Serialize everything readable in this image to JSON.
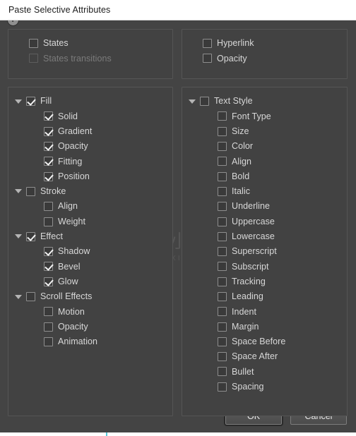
{
  "window": {
    "title": "Paste Selective Attributes"
  },
  "panels": {
    "states": {
      "name": "states-panel",
      "rows": [
        {
          "label": "States",
          "checked": false,
          "disabled": false,
          "indent": "flat",
          "triangle": false
        },
        {
          "label": "States transitions",
          "checked": false,
          "disabled": true,
          "indent": "flat",
          "triangle": false
        }
      ]
    },
    "hyperlink": {
      "name": "hyperlink-panel",
      "rows": [
        {
          "label": "Hyperlink",
          "checked": false,
          "disabled": false,
          "indent": "flat",
          "triangle": false
        },
        {
          "label": "Opacity",
          "checked": false,
          "disabled": false,
          "indent": "flat",
          "triangle": false
        }
      ]
    },
    "objects": {
      "name": "object-attributes-panel",
      "rows": [
        {
          "label": "Fill",
          "checked": true,
          "disabled": false,
          "indent": "parent",
          "triangle": true
        },
        {
          "label": "Solid",
          "checked": true,
          "disabled": false,
          "indent": "child",
          "triangle": false
        },
        {
          "label": "Gradient",
          "checked": true,
          "disabled": false,
          "indent": "child",
          "triangle": false
        },
        {
          "label": "Opacity",
          "checked": true,
          "disabled": false,
          "indent": "child",
          "triangle": false
        },
        {
          "label": "Fitting",
          "checked": true,
          "disabled": false,
          "indent": "child",
          "triangle": false
        },
        {
          "label": "Position",
          "checked": true,
          "disabled": false,
          "indent": "child",
          "triangle": false
        },
        {
          "label": "Stroke",
          "checked": false,
          "disabled": false,
          "indent": "parent",
          "triangle": true
        },
        {
          "label": "Align",
          "checked": false,
          "disabled": false,
          "indent": "child",
          "triangle": false
        },
        {
          "label": "Weight",
          "checked": false,
          "disabled": false,
          "indent": "child",
          "triangle": false
        },
        {
          "label": "Effect",
          "checked": true,
          "disabled": false,
          "indent": "parent",
          "triangle": true
        },
        {
          "label": "Shadow",
          "checked": true,
          "disabled": false,
          "indent": "child",
          "triangle": false
        },
        {
          "label": "Bevel",
          "checked": true,
          "disabled": false,
          "indent": "child",
          "triangle": false
        },
        {
          "label": "Glow",
          "checked": true,
          "disabled": false,
          "indent": "child",
          "triangle": false
        },
        {
          "label": "Scroll Effects",
          "checked": false,
          "disabled": false,
          "indent": "parent",
          "triangle": true
        },
        {
          "label": "Motion",
          "checked": false,
          "disabled": false,
          "indent": "child",
          "triangle": false
        },
        {
          "label": "Opacity",
          "checked": false,
          "disabled": false,
          "indent": "child",
          "triangle": false
        },
        {
          "label": "Animation",
          "checked": false,
          "disabled": false,
          "indent": "child",
          "triangle": false
        }
      ]
    },
    "text": {
      "name": "text-style-panel",
      "rows": [
        {
          "label": "Text Style",
          "checked": false,
          "disabled": false,
          "indent": "parent",
          "triangle": true
        },
        {
          "label": "Font Type",
          "checked": false,
          "disabled": false,
          "indent": "child",
          "triangle": false
        },
        {
          "label": "Size",
          "checked": false,
          "disabled": false,
          "indent": "child",
          "triangle": false
        },
        {
          "label": "Color",
          "checked": false,
          "disabled": false,
          "indent": "child",
          "triangle": false
        },
        {
          "label": "Align",
          "checked": false,
          "disabled": false,
          "indent": "child",
          "triangle": false
        },
        {
          "label": "Bold",
          "checked": false,
          "disabled": false,
          "indent": "child",
          "triangle": false
        },
        {
          "label": "Italic",
          "checked": false,
          "disabled": false,
          "indent": "child",
          "triangle": false
        },
        {
          "label": "Underline",
          "checked": false,
          "disabled": false,
          "indent": "child",
          "triangle": false
        },
        {
          "label": "Uppercase",
          "checked": false,
          "disabled": false,
          "indent": "child",
          "triangle": false
        },
        {
          "label": "Lowercase",
          "checked": false,
          "disabled": false,
          "indent": "child",
          "triangle": false
        },
        {
          "label": "Superscript",
          "checked": false,
          "disabled": false,
          "indent": "child",
          "triangle": false
        },
        {
          "label": "Subscript",
          "checked": false,
          "disabled": false,
          "indent": "child",
          "triangle": false
        },
        {
          "label": "Tracking",
          "checked": false,
          "disabled": false,
          "indent": "child",
          "triangle": false
        },
        {
          "label": "Leading",
          "checked": false,
          "disabled": false,
          "indent": "child",
          "triangle": false
        },
        {
          "label": "Indent",
          "checked": false,
          "disabled": false,
          "indent": "child",
          "triangle": false
        },
        {
          "label": "Margin",
          "checked": false,
          "disabled": false,
          "indent": "child",
          "triangle": false
        },
        {
          "label": "Space Before",
          "checked": false,
          "disabled": false,
          "indent": "child",
          "triangle": false
        },
        {
          "label": "Space After",
          "checked": false,
          "disabled": false,
          "indent": "child",
          "triangle": false
        },
        {
          "label": "Bullet",
          "checked": false,
          "disabled": false,
          "indent": "child",
          "triangle": false
        },
        {
          "label": "Spacing",
          "checked": false,
          "disabled": false,
          "indent": "child",
          "triangle": false
        }
      ]
    }
  },
  "footer": {
    "help_glyph": "?",
    "ok_label": "OK",
    "cancel_label": "Cancel"
  },
  "watermark": {
    "primary_text": "小牛知识",
    "secondary_text": "XIAO NIU ZHI SHI"
  },
  "colors": {
    "titlebar_bg": "#ffffff",
    "dialog_bg": "#444444",
    "panel_bg": "#424242",
    "panel_border": "#555555",
    "text": "#d8d8d8",
    "text_disabled": "#7b7b7b",
    "checkbox_border": "#8e8e8e",
    "checkmark": "#f2f2f2",
    "accent_cyan": "#56c8d8"
  }
}
